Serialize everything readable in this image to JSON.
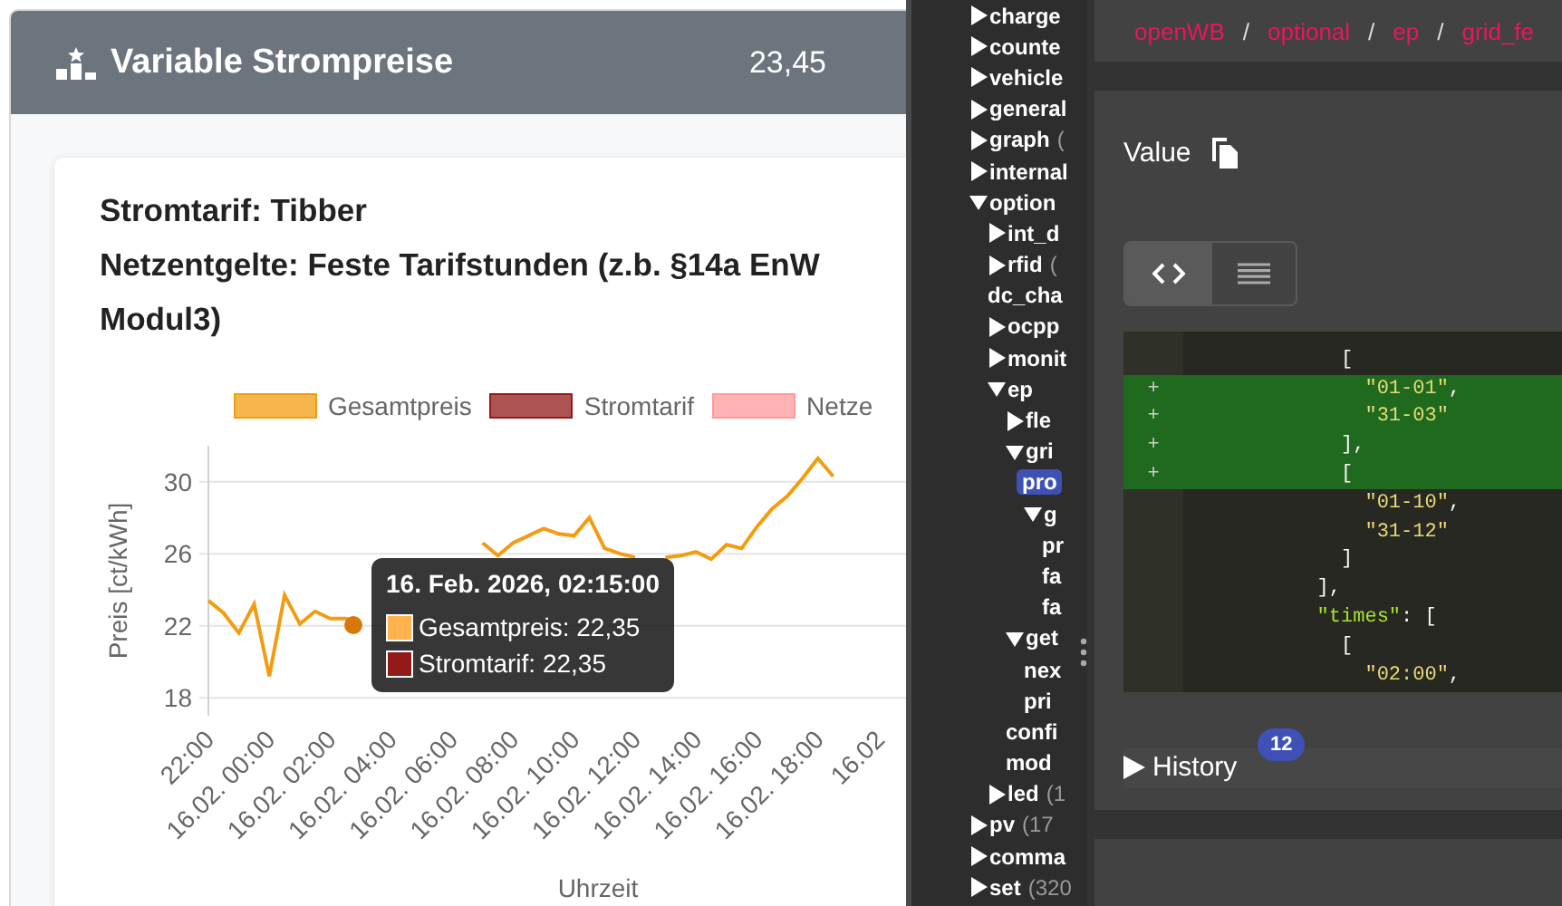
{
  "widget": {
    "title": "Variable Strompreise",
    "value": "23,45",
    "card": {
      "title": "Stromtarif: Tibber",
      "subtitle_lines": [
        "Netzentgelte: Feste Tarifstunden (z.b. §14a EnW",
        "Modul3)"
      ],
      "chart_data": {
        "type": "line",
        "xlabel": "Uhrzeit",
        "ylabel": "Preis [ct/kWh]",
        "categories": [
          "22:00",
          null,
          null,
          null,
          "16.02. 00:00",
          null,
          null,
          null,
          "16.02. 02:00",
          null,
          null,
          null,
          "16.02. 04:00",
          null,
          null,
          null,
          "16.02. 06:00",
          null,
          null,
          null,
          "16.02. 08:00",
          null,
          null,
          null,
          "16.02. 10:00",
          null,
          null,
          null,
          "16.02. 12:00",
          null,
          null,
          null,
          "16.02. 14:00",
          null,
          null,
          null,
          "16.02. 16:00",
          null,
          null,
          null,
          "16.02. 18:00",
          null,
          null,
          null,
          "16.02"
        ],
        "series": [
          {
            "name": "Gesamtpreis",
            "color": "#f39c12",
            "values": [
              23.4,
              22.7,
              21.6,
              23.2,
              19.2,
              23.7,
              22.1,
              22.8,
              22.4,
              22.4,
              22.2,
              null,
              null,
              null,
              null,
              null,
              null,
              null,
              26.6,
              25.9,
              26.6,
              27.0,
              27.4,
              27.1,
              27.0,
              28.0,
              26.3,
              26.0,
              25.8,
              null,
              25.8,
              25.9,
              26.1,
              25.7,
              26.5,
              26.3,
              27.5,
              28.5,
              29.2,
              30.2,
              31.3,
              30.3,
              null,
              null,
              null
            ]
          },
          {
            "name": "Stromtarif",
            "color": "#931a1a",
            "values": [
              null,
              null,
              null,
              null,
              null,
              null,
              null,
              null,
              null,
              null,
              null,
              null,
              null,
              null,
              null,
              null,
              null,
              null,
              null,
              null,
              null,
              null,
              null,
              null,
              null,
              null,
              null,
              null,
              null,
              null,
              null,
              null,
              null,
              null,
              null,
              null,
              null,
              null,
              null,
              null,
              null,
              null,
              null,
              null,
              null
            ]
          },
          {
            "name": "Netze",
            "color": "#ff9a9a",
            "values": [
              null,
              null,
              null,
              null,
              null,
              null,
              null,
              null,
              null,
              null,
              null,
              null,
              null,
              null,
              null,
              null,
              null,
              null,
              null,
              null,
              null,
              null,
              null,
              null,
              null,
              null,
              null,
              null,
              null,
              null,
              null,
              null,
              null,
              null,
              null,
              null,
              null,
              null,
              null,
              null,
              null,
              null,
              null,
              null,
              null
            ]
          }
        ],
        "ylim": [
          17,
          32
        ],
        "yticks": [
          18,
          22,
          26,
          30
        ],
        "grid": true
      },
      "tooltip": {
        "title": "16. Feb. 2026, 02:15:00",
        "items": [
          {
            "text": "Gesamtpreis: 22,35",
            "color": "#ffb24d"
          },
          {
            "text": "Stromtarif: 22,35",
            "color": "#931a1a"
          }
        ]
      }
    }
  },
  "tree": [
    {
      "label": "charge",
      "kind": "branch",
      "expanded": false,
      "selected": false
    },
    {
      "label": "counte",
      "kind": "branch",
      "expanded": false,
      "selected": false
    },
    {
      "label": "vehicle",
      "kind": "branch",
      "expanded": false,
      "selected": false
    },
    {
      "label": "general",
      "kind": "branch",
      "expanded": false,
      "selected": false
    },
    {
      "label": "graph",
      "count": "(",
      "kind": "branch",
      "expanded": false,
      "selected": false
    },
    {
      "label": "internal",
      "kind": "branch",
      "expanded": false,
      "selected": false
    },
    {
      "label": "option",
      "kind": "branch",
      "expanded": true,
      "selected": false,
      "children": [
        {
          "label": "int_d",
          "kind": "branch",
          "expanded": false,
          "selected": false
        },
        {
          "label": "rfid",
          "count": "(",
          "kind": "branch",
          "expanded": false,
          "selected": false
        },
        {
          "label": "dc_cha",
          "kind": "leaf",
          "selected": false
        },
        {
          "label": "ocpp",
          "kind": "branch",
          "expanded": false,
          "selected": false
        },
        {
          "label": "monit",
          "kind": "branch",
          "expanded": false,
          "selected": false
        },
        {
          "label": "ep",
          "kind": "branch",
          "expanded": true,
          "selected": false,
          "children": [
            {
              "label": "fle",
              "kind": "branch",
              "expanded": false,
              "selected": false
            },
            {
              "label": "gri",
              "kind": "branch",
              "expanded": true,
              "selected": false,
              "children": [
                {
                  "label": "pro",
                  "kind": "leaf",
                  "selected": true
                },
                {
                  "label": "g",
                  "kind": "branch",
                  "expanded": true,
                  "selected": false,
                  "children": [
                    {
                      "label": "pr",
                      "kind": "leaf",
                      "selected": false
                    },
                    {
                      "label": "fa",
                      "kind": "leaf",
                      "selected": false
                    },
                    {
                      "label": "fa",
                      "kind": "leaf",
                      "selected": false
                    }
                  ]
                }
              ]
            },
            {
              "label": "get",
              "kind": "branch",
              "expanded": true,
              "selected": false,
              "children": [
                {
                  "label": "nex",
                  "kind": "leaf",
                  "selected": false
                },
                {
                  "label": "pri",
                  "kind": "leaf",
                  "selected": false
                }
              ]
            },
            {
              "label": "confi",
              "kind": "leaf",
              "selected": false
            },
            {
              "label": "mod",
              "kind": "leaf",
              "selected": false
            }
          ]
        },
        {
          "label": "led",
          "count": "(1",
          "kind": "branch",
          "expanded": false,
          "selected": false
        }
      ]
    },
    {
      "label": "pv",
      "count": "(17",
      "kind": "branch",
      "expanded": false,
      "selected": false
    },
    {
      "label": "comma",
      "kind": "branch",
      "expanded": false,
      "selected": false
    },
    {
      "label": "set",
      "count": "(320",
      "kind": "branch",
      "expanded": false,
      "selected": false
    }
  ],
  "breadcrumb": [
    {
      "kind": "segment",
      "text": "openWB"
    },
    {
      "kind": "separator",
      "text": "/"
    },
    {
      "kind": "segment",
      "text": "optional"
    },
    {
      "kind": "separator",
      "text": "/"
    },
    {
      "kind": "segment",
      "text": "ep"
    },
    {
      "kind": "separator",
      "text": "/"
    },
    {
      "kind": "segment",
      "text": "grid_fe"
    }
  ],
  "value_section": {
    "label": "Value",
    "view_toggle": [
      {
        "kind": "code",
        "selected": true
      },
      {
        "kind": "list",
        "selected": false
      }
    ],
    "code_lines": [
      {
        "added": false,
        "tokens": [
          {
            "kind": "punct",
            "text": "          ["
          }
        ]
      },
      {
        "added": true,
        "gutter": "+",
        "tokens": [
          {
            "kind": "string",
            "text": "            \"01-01\""
          },
          {
            "kind": "punct",
            "text": ","
          }
        ]
      },
      {
        "added": true,
        "gutter": "+",
        "tokens": [
          {
            "kind": "string",
            "text": "            \"31-03\""
          }
        ]
      },
      {
        "added": true,
        "gutter": "+",
        "tokens": [
          {
            "kind": "punct",
            "text": "          ],"
          }
        ]
      },
      {
        "added": true,
        "gutter": "+",
        "tokens": [
          {
            "kind": "punct",
            "text": "          ["
          }
        ]
      },
      {
        "added": false,
        "tokens": [
          {
            "kind": "string",
            "text": "            \"01-10\""
          },
          {
            "kind": "punct",
            "text": ","
          }
        ]
      },
      {
        "added": false,
        "tokens": [
          {
            "kind": "string",
            "text": "            \"31-12\""
          }
        ]
      },
      {
        "added": false,
        "tokens": [
          {
            "kind": "punct",
            "text": "          ]"
          }
        ]
      },
      {
        "added": false,
        "tokens": [
          {
            "kind": "punct",
            "text": "        ],"
          }
        ]
      },
      {
        "added": false,
        "tokens": [
          {
            "kind": "key",
            "text": "        \"times\""
          },
          {
            "kind": "punct",
            "text": ": ["
          }
        ]
      },
      {
        "added": false,
        "tokens": [
          {
            "kind": "punct",
            "text": "          ["
          }
        ]
      },
      {
        "added": false,
        "tokens": [
          {
            "kind": "string",
            "text": "            \"02:00\""
          },
          {
            "kind": "punct",
            "text": ","
          }
        ]
      }
    ],
    "history": {
      "label": "History",
      "badge": "12",
      "expanded": false
    }
  }
}
